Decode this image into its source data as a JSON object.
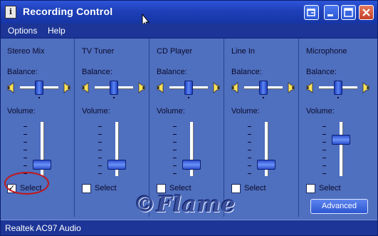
{
  "window": {
    "title": "Recording Control"
  },
  "menu": {
    "items": [
      "Options",
      "Help"
    ]
  },
  "labels": {
    "balance": "Balance:",
    "volume": "Volume:",
    "select": "Select"
  },
  "channels": [
    {
      "name": "Stereo Mix",
      "selected": true,
      "volume_level": 0.12,
      "balance": 0.5
    },
    {
      "name": "TV Tuner",
      "selected": false,
      "volume_level": 0.12,
      "balance": 0.5
    },
    {
      "name": "CD Player",
      "selected": false,
      "volume_level": 0.12,
      "balance": 0.5
    },
    {
      "name": "Line In",
      "selected": false,
      "volume_level": 0.12,
      "balance": 0.5
    },
    {
      "name": "Microphone",
      "selected": false,
      "volume_level": 0.7,
      "balance": 0.5
    }
  ],
  "advanced_button": {
    "label": "Advanced"
  },
  "watermark": "©Flame",
  "status_bar": {
    "text": "Realtek AC97 Audio"
  },
  "colors": {
    "window_body": "#4f6fbf",
    "title_bar": "#1e3fb8",
    "highlight_ring": "#c01818"
  }
}
